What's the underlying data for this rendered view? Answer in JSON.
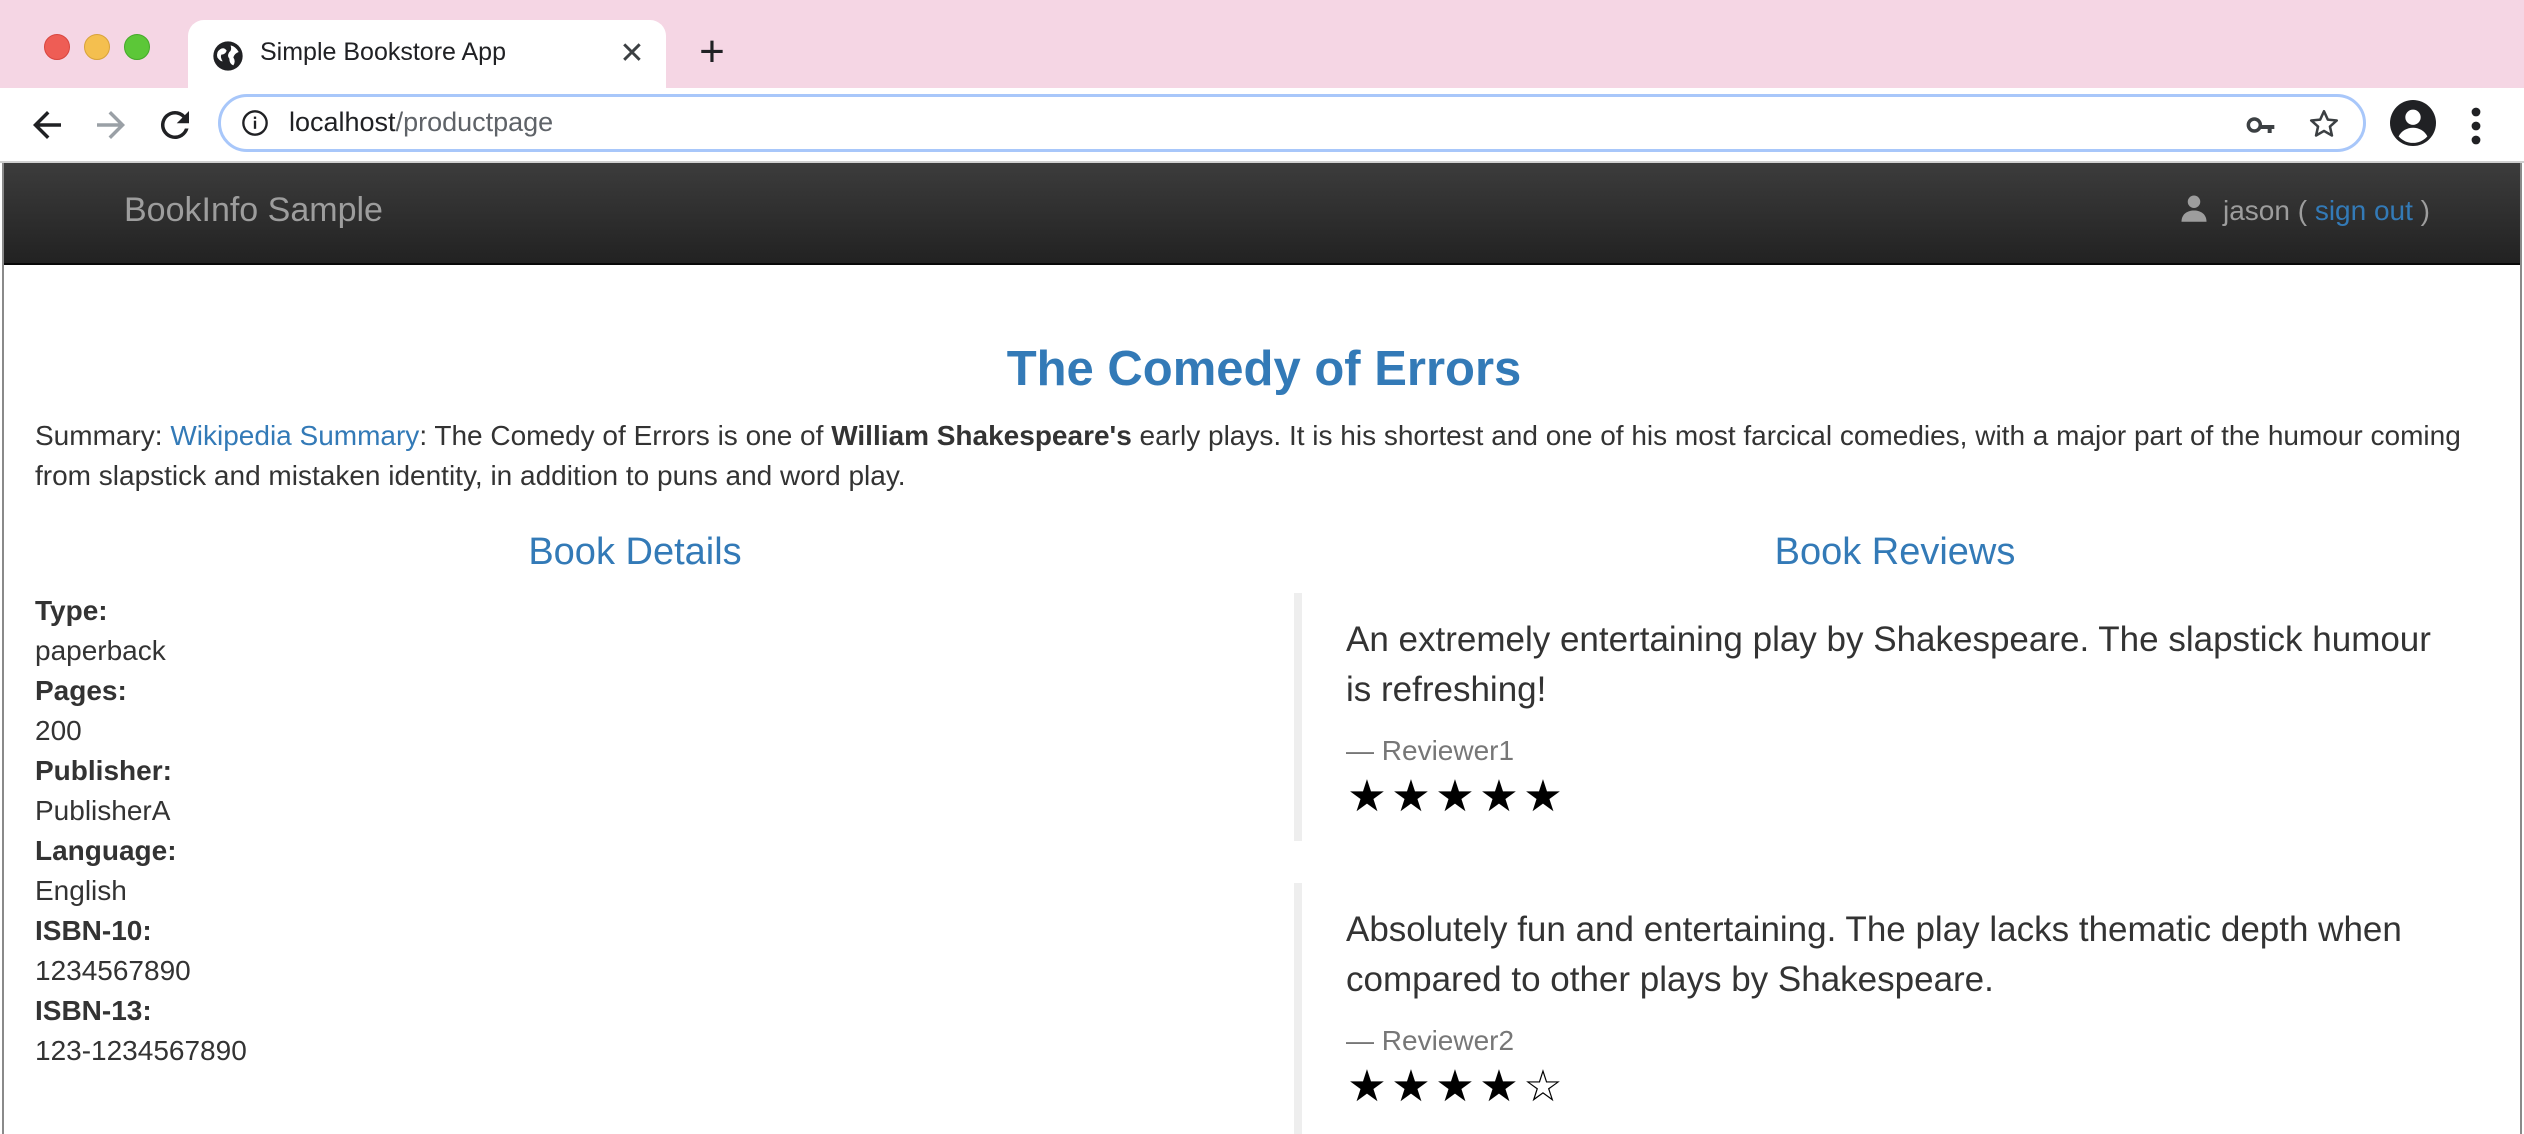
{
  "browser": {
    "tab_title": "Simple Bookstore App",
    "url_host": "localhost",
    "url_path": "/productpage",
    "icons": [
      "globe-icon",
      "close-icon",
      "plus-icon",
      "back-arrow-icon",
      "forward-arrow-icon",
      "reload-icon",
      "info-icon",
      "key-icon",
      "star-icon",
      "profile-icon",
      "more-vert-icon"
    ]
  },
  "navbar": {
    "brand": "BookInfo Sample",
    "user": "jason",
    "open_paren": " ( ",
    "sign_out": "sign out",
    "close_paren": " )",
    "background": "#222222"
  },
  "product": {
    "title": "The Comedy of Errors",
    "summary_prefix": "Summary: ",
    "summary_link": "Wikipedia Summary",
    "summary_mid": ": The Comedy of Errors is one of ",
    "summary_bold": "William Shakespeare's",
    "summary_rest": " early plays. It is his shortest and one of his most farcical comedies, with a major part of the humour coming from slapstick and mistaken identity, in addition to puns and word play."
  },
  "details": {
    "heading": "Book Details",
    "rows": [
      {
        "label": "Type:",
        "value": "paperback"
      },
      {
        "label": "Pages:",
        "value": "200"
      },
      {
        "label": "Publisher:",
        "value": "PublisherA"
      },
      {
        "label": "Language:",
        "value": "English"
      },
      {
        "label": "ISBN-10:",
        "value": "1234567890"
      },
      {
        "label": "ISBN-13:",
        "value": "123-1234567890"
      }
    ]
  },
  "reviews": {
    "heading": "Book Reviews",
    "items": [
      {
        "text": "An extremely entertaining play by Shakespeare. The slapstick humour is refreshing!",
        "author": "— Reviewer1",
        "rating": 5,
        "max": 5
      },
      {
        "text": "Absolutely fun and entertaining. The play lacks thematic depth when compared to other plays by Shakespeare.",
        "author": "— Reviewer2",
        "rating": 4,
        "max": 5
      }
    ]
  },
  "colors": {
    "accent": "#337ab7",
    "tabbar": "#f5d6e4"
  }
}
